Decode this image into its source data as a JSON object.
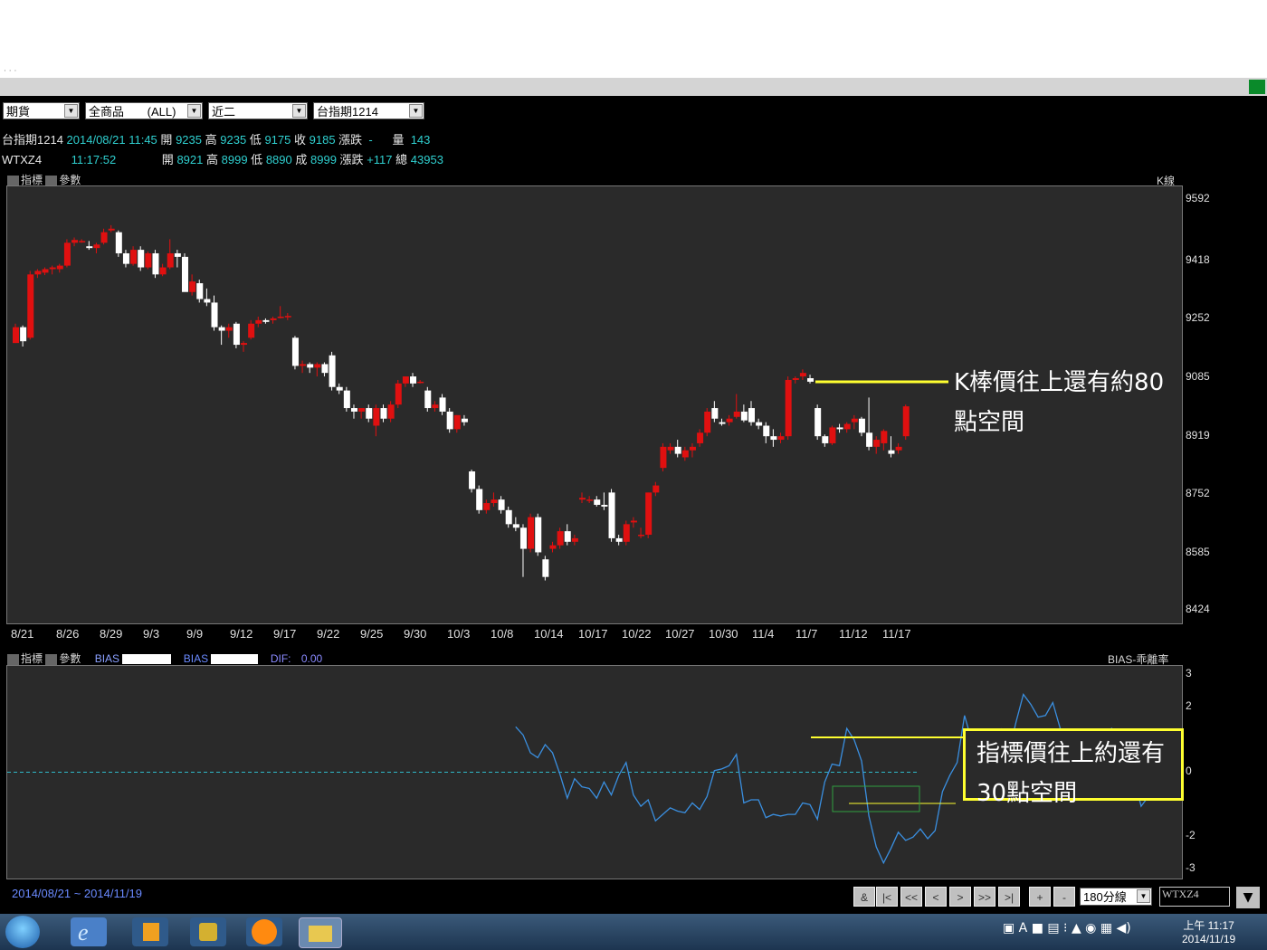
{
  "toolbar": {
    "select_market": "期貨",
    "select_product": "全商品",
    "select_product_scope": "(ALL)",
    "select_period": "近二",
    "select_symbol": "台指期1214"
  },
  "quote_rows": [
    {
      "name": "台指期1214",
      "date": "2014/08/21 11:45",
      "open_label": "開",
      "open": "9235",
      "high_label": "高",
      "high": "9235",
      "low_label": "低",
      "low": "9175",
      "close_label": "收",
      "close": "9185",
      "chg_label": "漲跌",
      "chg": "-",
      "vol_label": "量",
      "vol": "143"
    },
    {
      "name": "WTXZ4",
      "date": "11:17:52",
      "open_label": "開",
      "open": "8921",
      "high_label": "高",
      "high": "8999",
      "low_label": "低",
      "low": "8890",
      "close_label": "成",
      "close": "8999",
      "chg_label": "漲跌",
      "chg": "+117",
      "vol_label": "總",
      "vol": "43953"
    }
  ],
  "kpanel": {
    "indicator_label": "指標",
    "param_label": "參數",
    "title": "K線"
  },
  "bias_panel": {
    "indicator_label": "指標",
    "param_label": "參數",
    "bias1_label": "BIAS",
    "bias2_label": "BIAS",
    "dif_label": "DIF:",
    "dif_value": "0.00",
    "title": "BIAS-乖離率"
  },
  "annotations": {
    "k_line1": "K棒價往上還有約80",
    "k_line2": "點空間",
    "bias_line1": "指標價往上約還有",
    "bias_line2": "30點空間"
  },
  "status": {
    "range_start": "2014/08/21",
    "tilde": "~",
    "range_end": "2014/11/19",
    "interval": "180分線",
    "symbol_box": "WTXZ4"
  },
  "nav_buttons": [
    "&",
    "|<",
    "<<",
    "<",
    ">",
    ">>",
    ">|",
    "+",
    "-"
  ],
  "taskbar": {
    "time": "上午 11:17",
    "date": "2014/11/19"
  },
  "colors": {
    "up": "#e01010",
    "down": "#ffffff",
    "bias_line": "#3a8fe0",
    "zero_line": "#2fb8c8",
    "annotation": "#ffff30",
    "panel_bg": "#2a2a2a"
  },
  "chart_data": [
    {
      "type": "candlestick",
      "title": "K線",
      "yticks": [
        9592,
        9418,
        9252,
        9085,
        8919,
        8752,
        8585,
        8424
      ],
      "ylim": [
        8424,
        9620
      ],
      "xticks": [
        "8/21",
        "8/26",
        "8/29",
        "9/3",
        "9/9",
        "9/12",
        "9/17",
        "9/22",
        "9/25",
        "9/30",
        "10/3",
        "10/8",
        "10/14",
        "10/17",
        "10/22",
        "10/27",
        "10/30",
        "11/4",
        "11/7",
        "11/12",
        "11/17"
      ],
      "candles": [
        [
          9185,
          9240,
          9185,
          9230
        ],
        [
          9230,
          9235,
          9175,
          9190
        ],
        [
          9200,
          9390,
          9195,
          9380
        ],
        [
          9380,
          9395,
          9370,
          9390
        ],
        [
          9385,
          9400,
          9378,
          9395
        ],
        [
          9395,
          9405,
          9380,
          9400
        ],
        [
          9395,
          9410,
          9385,
          9405
        ],
        [
          9405,
          9480,
          9400,
          9470
        ],
        [
          9470,
          9485,
          9460,
          9478
        ],
        [
          9475,
          9480,
          9470,
          9475
        ],
        [
          9460,
          9475,
          9450,
          9455
        ],
        [
          9455,
          9470,
          9440,
          9465
        ],
        [
          9470,
          9510,
          9465,
          9500
        ],
        [
          9505,
          9520,
          9500,
          9510
        ],
        [
          9500,
          9505,
          9430,
          9440
        ],
        [
          9440,
          9450,
          9400,
          9410
        ],
        [
          9410,
          9460,
          9405,
          9450
        ],
        [
          9450,
          9460,
          9390,
          9400
        ],
        [
          9400,
          9445,
          9395,
          9440
        ],
        [
          9440,
          9450,
          9370,
          9380
        ],
        [
          9380,
          9410,
          9375,
          9400
        ],
        [
          9400,
          9480,
          9395,
          9440
        ],
        [
          9440,
          9450,
          9400,
          9430
        ],
        [
          9430,
          9440,
          9370,
          9330
        ],
        [
          9330,
          9380,
          9320,
          9360
        ],
        [
          9355,
          9365,
          9300,
          9310
        ],
        [
          9310,
          9340,
          9290,
          9300
        ],
        [
          9300,
          9320,
          9220,
          9230
        ],
        [
          9230,
          9235,
          9180,
          9220
        ],
        [
          9220,
          9240,
          9200,
          9230
        ],
        [
          9240,
          9245,
          9170,
          9180
        ],
        [
          9180,
          9190,
          9160,
          9185
        ],
        [
          9200,
          9250,
          9195,
          9240
        ],
        [
          9240,
          9260,
          9230,
          9250
        ],
        [
          9250,
          9255,
          9240,
          9245
        ],
        [
          9250,
          9260,
          9240,
          9255
        ],
        [
          9260,
          9290,
          9255,
          9260
        ],
        [
          9260,
          9270,
          9250,
          9262
        ],
        [
          9200,
          9205,
          9110,
          9120
        ],
        [
          9120,
          9135,
          9100,
          9125
        ],
        [
          9125,
          9130,
          9100,
          9115
        ],
        [
          9115,
          9130,
          9090,
          9125
        ],
        [
          9125,
          9130,
          9090,
          9100
        ],
        [
          9150,
          9160,
          9050,
          9060
        ],
        [
          9060,
          9070,
          9040,
          9050
        ],
        [
          9050,
          9060,
          8990,
          9000
        ],
        [
          9000,
          9010,
          8970,
          8990
        ],
        [
          8990,
          9000,
          8970,
          9000
        ],
        [
          9000,
          9010,
          8960,
          8970
        ],
        [
          8950,
          9010,
          8920,
          9000
        ],
        [
          9000,
          9010,
          8960,
          8970
        ],
        [
          8970,
          9020,
          8960,
          9010
        ],
        [
          9010,
          9080,
          9000,
          9070
        ],
        [
          9070,
          9090,
          9060,
          9090
        ],
        [
          9090,
          9100,
          9060,
          9070
        ],
        [
          9075,
          9080,
          9070,
          9075
        ],
        [
          9050,
          9060,
          8990,
          9000
        ],
        [
          9000,
          9020,
          8990,
          9010
        ],
        [
          9030,
          9040,
          8980,
          8990
        ],
        [
          8990,
          9000,
          8930,
          8940
        ],
        [
          8940,
          8980,
          8930,
          8980
        ],
        [
          8970,
          8980,
          8950,
          8960
        ],
        [
          8820,
          8825,
          8760,
          8770
        ],
        [
          8770,
          8780,
          8700,
          8710
        ],
        [
          8710,
          8740,
          8700,
          8730
        ],
        [
          8730,
          8760,
          8720,
          8740
        ],
        [
          8740,
          8750,
          8700,
          8710
        ],
        [
          8710,
          8720,
          8660,
          8670
        ],
        [
          8670,
          8690,
          8650,
          8660
        ],
        [
          8660,
          8670,
          8520,
          8600
        ],
        [
          8600,
          8700,
          8590,
          8690
        ],
        [
          8690,
          8700,
          8580,
          8590
        ],
        [
          8570,
          8580,
          8510,
          8520
        ],
        [
          8600,
          8620,
          8590,
          8610
        ],
        [
          8610,
          8660,
          8600,
          8650
        ],
        [
          8650,
          8670,
          8610,
          8620
        ],
        [
          8620,
          8640,
          8610,
          8630
        ],
        [
          8740,
          8760,
          8730,
          8745
        ],
        [
          8740,
          8750,
          8730,
          8740
        ],
        [
          8740,
          8750,
          8720,
          8725
        ],
        [
          8725,
          8760,
          8710,
          8720
        ],
        [
          8760,
          8770,
          8620,
          8630
        ],
        [
          8630,
          8640,
          8610,
          8620
        ],
        [
          8620,
          8680,
          8610,
          8670
        ],
        [
          8675,
          8690,
          8660,
          8680
        ],
        [
          8640,
          8660,
          8630,
          8640
        ],
        [
          8640,
          8760,
          8630,
          8760
        ],
        [
          8760,
          8790,
          8750,
          8780
        ],
        [
          8830,
          8900,
          8820,
          8890
        ],
        [
          8880,
          8900,
          8870,
          8890
        ],
        [
          8890,
          8910,
          8860,
          8870
        ],
        [
          8860,
          8890,
          8850,
          8880
        ],
        [
          8880,
          8900,
          8860,
          8890
        ],
        [
          8900,
          8940,
          8890,
          8930
        ],
        [
          8930,
          9000,
          8920,
          8990
        ],
        [
          9000,
          9020,
          8960,
          8970
        ],
        [
          8960,
          8970,
          8950,
          8955
        ],
        [
          8960,
          8980,
          8950,
          8970
        ],
        [
          8975,
          9040,
          8970,
          8990
        ],
        [
          8990,
          9010,
          8960,
          8965
        ],
        [
          9000,
          9020,
          8950,
          8960
        ],
        [
          8960,
          8970,
          8940,
          8950
        ],
        [
          8950,
          8960,
          8900,
          8920
        ],
        [
          8920,
          8940,
          8890,
          8910
        ],
        [
          8910,
          8930,
          8900,
          8920
        ],
        [
          8920,
          9090,
          8910,
          9080
        ],
        [
          9080,
          9090,
          9070,
          9085
        ],
        [
          9090,
          9110,
          9080,
          9100
        ],
        [
          9085,
          9095,
          9070,
          9075
        ],
        [
          9000,
          9010,
          8910,
          8920
        ],
        [
          8920,
          8925,
          8890,
          8900
        ],
        [
          8900,
          8950,
          8895,
          8945
        ],
        [
          8945,
          8955,
          8930,
          8940
        ],
        [
          8940,
          8960,
          8930,
          8955
        ],
        [
          8960,
          8980,
          8940,
          8970
        ],
        [
          8970,
          8975,
          8920,
          8930
        ],
        [
          8930,
          9030,
          8880,
          8890
        ],
        [
          8890,
          8920,
          8870,
          8910
        ],
        [
          8900,
          8940,
          8880,
          8935
        ],
        [
          8880,
          8920,
          8860,
          8870
        ],
        [
          8880,
          8900,
          8870,
          8890
        ],
        [
          8920,
          9010,
          8910,
          9005
        ]
      ]
    },
    {
      "type": "line",
      "title": "BIAS-乖離率",
      "yticks": [
        3,
        2,
        0,
        -2,
        -3
      ],
      "ylim": [
        -3,
        3
      ],
      "zero_line": 0,
      "series": [
        {
          "name": "BIAS",
          "values": [
            0,
            0,
            0,
            0,
            0,
            0,
            0,
            0,
            0,
            0,
            0,
            0,
            0,
            0,
            0,
            0,
            0,
            0,
            0,
            0,
            0,
            0,
            0,
            0,
            0,
            0,
            0,
            0,
            0,
            0,
            0,
            0,
            0,
            0,
            0,
            0,
            0,
            0,
            0,
            0,
            0,
            0,
            0,
            0,
            0,
            0,
            0,
            0,
            0,
            0,
            0,
            0,
            0,
            0,
            0,
            0,
            0,
            0,
            0,
            0,
            0,
            0,
            0,
            0,
            0,
            0,
            0,
            0,
            1.4,
            1.15,
            0.6,
            0.45,
            0.85,
            0.6,
            -0.05,
            -0.8,
            -0.2,
            -0.45,
            -0.5,
            -0.8,
            -0.3,
            -0.7,
            -0.1,
            0.3,
            -0.7,
            -1.05,
            -0.85,
            -1.5,
            -1.3,
            -1.1,
            -1.2,
            -1.25,
            -0.95,
            -1.15,
            -0.75,
            0.05,
            0.1,
            0.2,
            0.55,
            -0.95,
            -0.85,
            -0.85,
            -1.4,
            -1.3,
            -1.35,
            -1.3,
            -1.3,
            -0.95,
            -1.0,
            -1.45,
            -0.3,
            0.25,
            0.2,
            1.35,
            1.0,
            0.35,
            -1.35,
            -2.3,
            -2.8,
            -2.35,
            -1.85,
            -2.1,
            -2.0,
            -1.75,
            -2.05,
            -1.8,
            -0.6,
            -0.1,
            0.3,
            1.75,
            0.95,
            -0.35,
            -0.4,
            -0.35,
            1.35,
            0.6,
            1.55,
            2.4,
            2.1,
            1.7,
            1.75,
            2.15,
            1.35,
            1.15,
            0.9,
            0.6,
            0.2,
            -0.85,
            -0.65,
            1.35,
            1.2,
            1.05,
            -0.15,
            -1.05,
            -0.75,
            -0.45,
            -0.05,
            -0.55,
            -0.85,
            -0.85,
            -0.7,
            0.95
          ]
        }
      ]
    }
  ]
}
